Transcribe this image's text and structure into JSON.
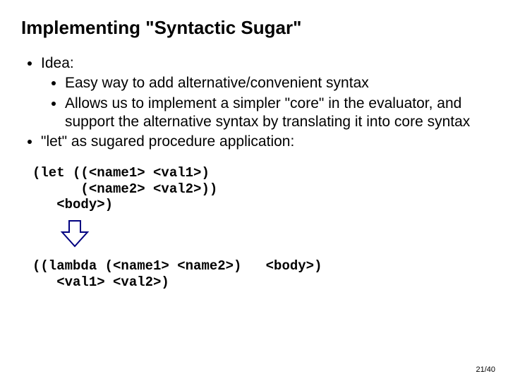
{
  "title": "Implementing \"Syntactic Sugar\"",
  "bullets": {
    "idea": "Idea:",
    "sub1": "Easy way to add alternative/convenient syntax",
    "sub2": "Allows us to implement a simpler \"core\" in the evaluator, and support the alternative syntax by translating it into core syntax",
    "let": "\"let\" as sugared procedure application:"
  },
  "code": {
    "let_block": "(let ((<name1> <val1>)\n      (<name2> <val2>))\n   <body>)",
    "lambda_block": "((lambda (<name1> <name2>)   <body>)\n   <val1> <val2>)"
  },
  "arrow": {
    "stroke": "#000080",
    "fill": "#ffffff"
  },
  "page": "21/40"
}
